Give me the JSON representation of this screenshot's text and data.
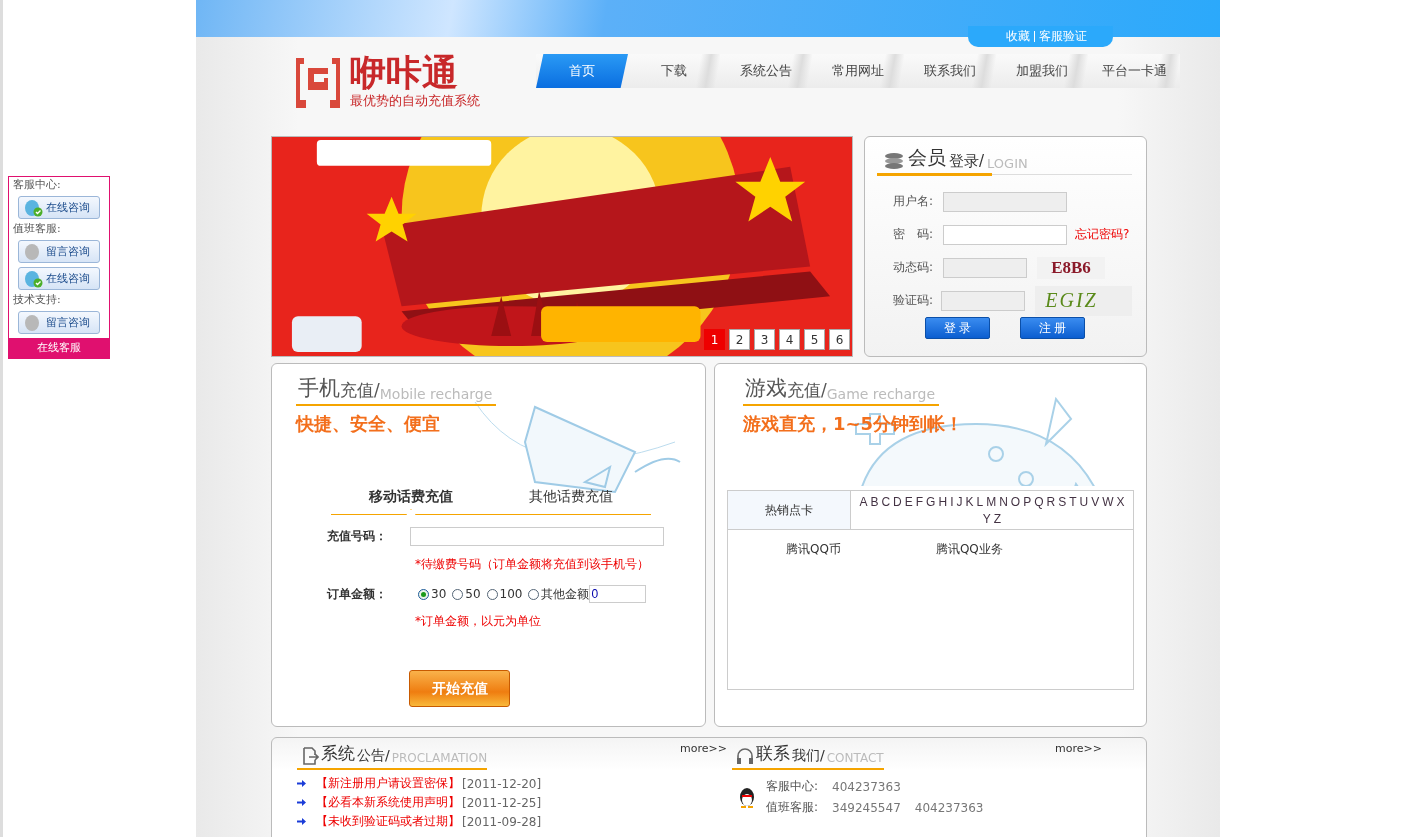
{
  "top_links": [
    {
      "label": "收藏"
    },
    {
      "label": "客服验证"
    }
  ],
  "logo": {
    "name": "咿咔通",
    "slogan": "最优势的自动充值系统"
  },
  "nav": [
    {
      "label": "首页",
      "selected": true
    },
    {
      "label": "下载",
      "selected": false
    },
    {
      "label": "系统公告",
      "selected": false
    },
    {
      "label": "常用网址",
      "selected": false
    },
    {
      "label": "联系我们",
      "selected": false
    },
    {
      "label": "加盟我们",
      "selected": false
    },
    {
      "label": "平台一卡通",
      "selected": false
    }
  ],
  "service": {
    "groups": [
      {
        "label": "客服中心:",
        "buttons": [
          {
            "kind": "online",
            "label": "在线咨询"
          }
        ]
      },
      {
        "label": "值班客服:",
        "buttons": [
          {
            "kind": "message",
            "label": "留言咨询"
          },
          {
            "kind": "online",
            "label": "在线咨询"
          }
        ]
      },
      {
        "label": "技术支持:",
        "buttons": [
          {
            "kind": "message",
            "label": "留言咨询"
          }
        ]
      }
    ],
    "footer": "在线客服"
  },
  "banner": {
    "kind": "picture",
    "pages": [
      {
        "label": "1",
        "selected": true
      },
      {
        "label": "2",
        "selected": false
      },
      {
        "label": "3",
        "selected": false
      },
      {
        "label": "4",
        "selected": false
      },
      {
        "label": "5",
        "selected": false
      },
      {
        "label": "6",
        "selected": false
      }
    ]
  },
  "login": {
    "title": "会员",
    "title_sub": "登录/",
    "title_en": "LOGIN",
    "fields": [
      {
        "label": "用户名:",
        "kind": "text"
      },
      {
        "label": "密　码:",
        "kind": "password",
        "link": "忘记密码?"
      },
      {
        "label": "动态码:",
        "kind": "code",
        "code": "E8B6"
      },
      {
        "label": "验证码:",
        "kind": "captcha",
        "code": "EGIZ"
      }
    ],
    "buttons": [
      "登 录",
      "注 册"
    ]
  },
  "mobile": {
    "title": "手机",
    "title_sub": "充值/",
    "title_en": "Mobile recharge",
    "slogan": "快捷、安全、便宜",
    "tabs": [
      {
        "label": "移动话费充值",
        "selected": true
      },
      {
        "label": "其他话费充值",
        "selected": false
      }
    ],
    "phone_label": "充值号码：",
    "phone_hint": "*待缴费号码（订单金额将充值到该手机号）",
    "amount_label": "订单金额：",
    "amounts": [
      {
        "label": "30",
        "selected": true
      },
      {
        "label": "50",
        "selected": false
      },
      {
        "label": "100",
        "selected": false
      },
      {
        "label": "其他金额",
        "selected": false
      }
    ],
    "other_amount": "0",
    "amount_hint": "*订单金额，以元为单位",
    "submit": "开始充值"
  },
  "game": {
    "title": "游戏",
    "title_sub": "充值/",
    "title_en": "Game recharge",
    "slogan": "游戏直充，1~5分钟到帐！",
    "hot_label": "热销点卡",
    "letters": [
      "A",
      "B",
      "C",
      "D",
      "E",
      "F",
      "G",
      "H",
      "I",
      "J",
      "K",
      "L",
      "M",
      "N",
      "O",
      "P",
      "Q",
      "R",
      "S",
      "T",
      "U",
      "V",
      "W",
      "X",
      "Y",
      "Z"
    ],
    "items": [
      "腾讯QQ币",
      "腾讯QQ业务"
    ]
  },
  "notices": {
    "title": "系统",
    "title_sub": "公告/",
    "title_en": "PROCLAMATION",
    "more": "more>>",
    "items": [
      {
        "text": "【新注册用户请设置密保】",
        "date": "[2011-12-20]"
      },
      {
        "text": "【必看本新系统使用声明】",
        "date": "[2011-12-25]"
      },
      {
        "text": "【未收到验证码或者过期】",
        "date": "[2011-09-28]"
      }
    ]
  },
  "contact": {
    "title": "联系",
    "title_sub": "我们/",
    "title_en": "CONTACT",
    "more": "more>>",
    "rows": [
      {
        "label": "客服中心:",
        "values": [
          "404237363"
        ]
      },
      {
        "label": "值班客服:",
        "values": [
          "349245547",
          "404237363"
        ]
      }
    ]
  }
}
